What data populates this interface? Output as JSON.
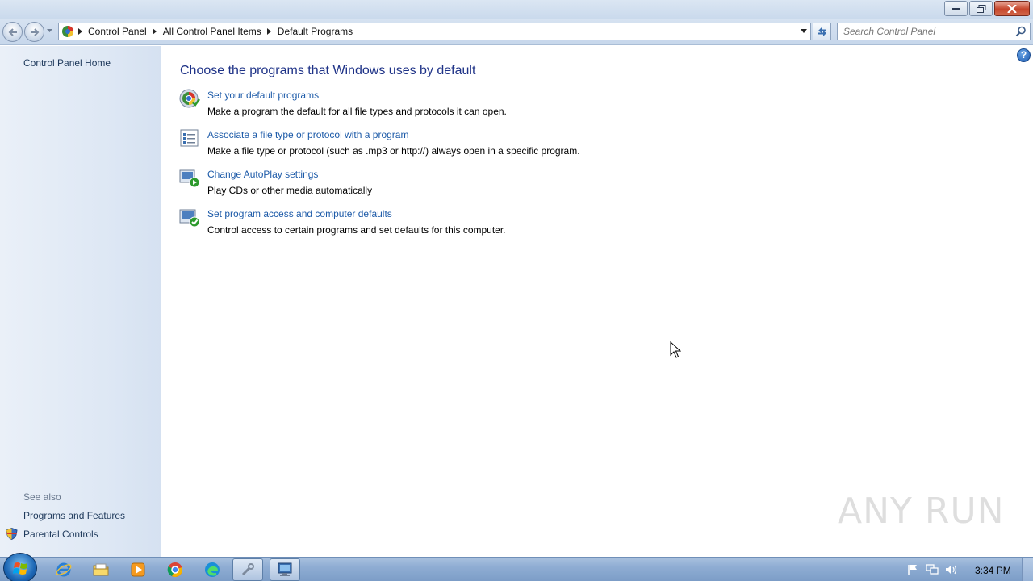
{
  "window": {
    "controls": [
      "minimize-icon",
      "maximize-icon",
      "close-icon"
    ]
  },
  "address": {
    "breadcrumbs": [
      "Control Panel",
      "All Control Panel Items",
      "Default Programs"
    ],
    "search_placeholder": "Search Control Panel"
  },
  "sidebar": {
    "home_label": "Control Panel Home",
    "see_also_label": "See also",
    "see_also_items": [
      {
        "label": "Programs and Features"
      },
      {
        "label": "Parental Controls",
        "icon": "shield-icon"
      }
    ]
  },
  "main": {
    "heading": "Choose the programs that Windows uses by default",
    "tasks": [
      {
        "link": "Set your default programs",
        "desc": "Make a program the default for all file types and protocols it can open.",
        "icon": "default-programs-icon"
      },
      {
        "link": "Associate a file type or protocol with a program",
        "desc": "Make a file type or protocol (such as .mp3 or http://) always open in a specific program.",
        "icon": "file-association-icon"
      },
      {
        "link": "Change AutoPlay settings",
        "desc": "Play CDs or other media automatically",
        "icon": "autoplay-icon"
      },
      {
        "link": "Set program access and computer defaults",
        "desc": "Control access to certain programs and set defaults for this computer.",
        "icon": "program-access-icon"
      }
    ],
    "help_icon": "?"
  },
  "watermark": "ANY RUN",
  "taskbar": {
    "items": [
      "internet-explorer-icon",
      "file-explorer-icon",
      "media-player-icon",
      "chrome-icon",
      "edge-icon",
      "tool-icon",
      "control-panel-icon"
    ],
    "clock": "3:34 PM"
  }
}
